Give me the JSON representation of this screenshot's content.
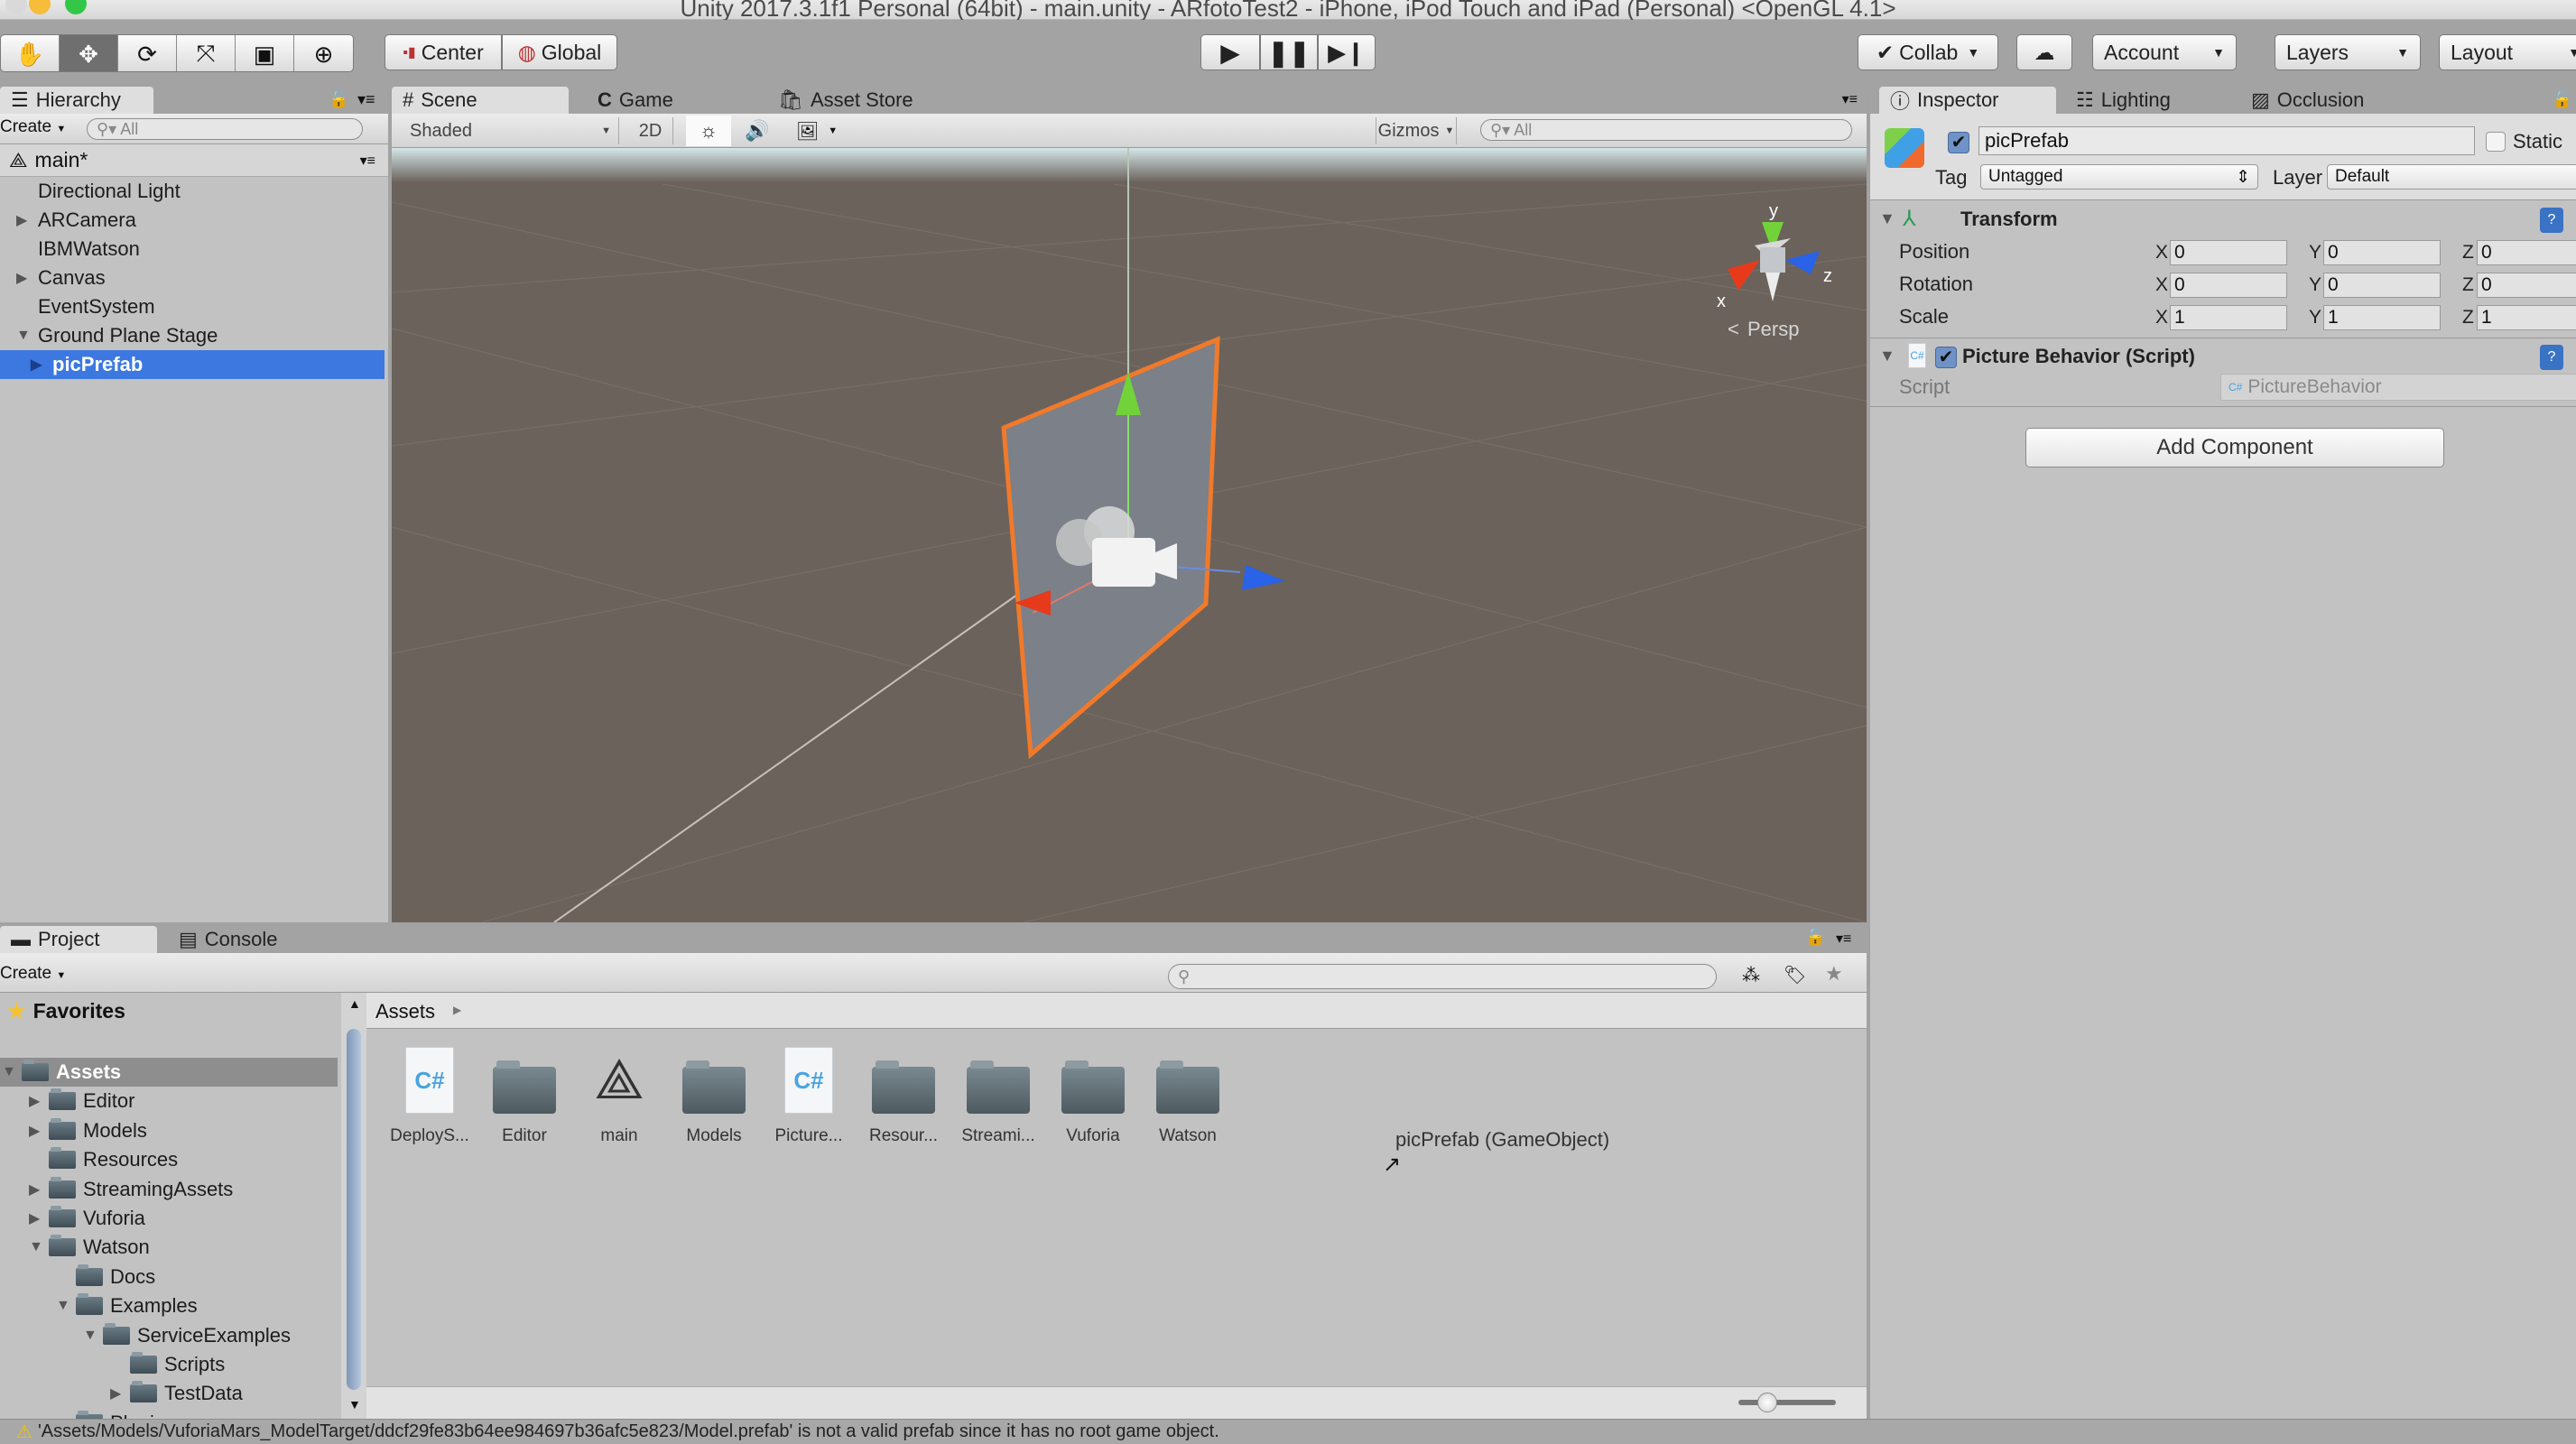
{
  "window": {
    "title": "Unity 2017.3.1f1 Personal (64bit) - main.unity - ARfotoTest2 - iPhone, iPod Touch and iPad (Personal) <OpenGL 4.1>"
  },
  "toolbar": {
    "tools": [
      "hand-tool",
      "move-tool",
      "rotate-tool",
      "scale-tool",
      "rect-tool",
      "transform-tool"
    ],
    "pivot_label": "Center",
    "space_label": "Global",
    "collab_label": "Collab",
    "account_label": "Account",
    "layers_label": "Layers",
    "layout_label": "Layout"
  },
  "hierarchy": {
    "tab_label": "Hierarchy",
    "create_label": "Create",
    "search_placeholder": "All",
    "scene_name": "main*",
    "items": [
      {
        "label": "Directional Light",
        "arrow": "",
        "indent": 1
      },
      {
        "label": "ARCamera",
        "arrow": "▶",
        "indent": 1
      },
      {
        "label": "IBMWatson",
        "arrow": "",
        "indent": 1
      },
      {
        "label": "Canvas",
        "arrow": "▶",
        "indent": 1
      },
      {
        "label": "EventSystem",
        "arrow": "",
        "indent": 1
      },
      {
        "label": "Ground Plane Stage",
        "arrow": "▼",
        "indent": 1
      },
      {
        "label": "picPrefab",
        "arrow": "▶",
        "indent": 2,
        "selected": true
      }
    ]
  },
  "scene_view": {
    "tabs": [
      {
        "label": "Scene",
        "icon": "#",
        "active": true
      },
      {
        "label": "Game",
        "icon": "C",
        "active": false
      },
      {
        "label": "Asset Store",
        "icon": "🛍",
        "active": false
      }
    ],
    "shading_mode": "Shaded",
    "toggle_2d": "2D",
    "gizmos_label": "Gizmos",
    "search_placeholder": "All",
    "projection_label": "Persp",
    "axis_labels": {
      "x": "x",
      "y": "y",
      "z": "z"
    }
  },
  "inspector": {
    "tabs": [
      {
        "label": "Inspector",
        "active": true
      },
      {
        "label": "Lighting",
        "active": false
      },
      {
        "label": "Occlusion",
        "active": false
      }
    ],
    "object_name": "picPrefab",
    "active_checked": true,
    "static_label": "Static",
    "static_checked": false,
    "tag_label": "Tag",
    "tag_value": "Untagged",
    "layer_label": "Layer",
    "layer_value": "Default",
    "transform": {
      "title": "Transform",
      "rows": [
        {
          "label": "Position",
          "x": "0",
          "y": "0",
          "z": "0"
        },
        {
          "label": "Rotation",
          "x": "0",
          "y": "0",
          "z": "0"
        },
        {
          "label": "Scale",
          "x": "1",
          "y": "1",
          "z": "1"
        }
      ]
    },
    "script_component": {
      "title": "Picture Behavior (Script)",
      "enabled": true,
      "script_label": "Script",
      "script_value": "PictureBehavior"
    },
    "add_component_label": "Add Component"
  },
  "project": {
    "tabs": [
      {
        "label": "Project",
        "active": true
      },
      {
        "label": "Console",
        "active": false
      }
    ],
    "create_label": "Create",
    "favorites_label": "Favorites",
    "tree": [
      {
        "label": "Assets",
        "arrow": "▼",
        "indent": 0,
        "selected": true
      },
      {
        "label": "Editor",
        "arrow": "▶",
        "indent": 1
      },
      {
        "label": "Models",
        "arrow": "▶",
        "indent": 1
      },
      {
        "label": "Resources",
        "arrow": "",
        "indent": 1
      },
      {
        "label": "StreamingAssets",
        "arrow": "▶",
        "indent": 1
      },
      {
        "label": "Vuforia",
        "arrow": "▶",
        "indent": 1
      },
      {
        "label": "Watson",
        "arrow": "▼",
        "indent": 1
      },
      {
        "label": "Docs",
        "arrow": "",
        "indent": 2
      },
      {
        "label": "Examples",
        "arrow": "▼",
        "indent": 2
      },
      {
        "label": "ServiceExamples",
        "arrow": "▼",
        "indent": 3
      },
      {
        "label": "Scripts",
        "arrow": "",
        "indent": 4
      },
      {
        "label": "TestData",
        "arrow": "▶",
        "indent": 4
      },
      {
        "label": "Plugins",
        "arrow": "",
        "indent": 2
      }
    ],
    "breadcrumb": "Assets",
    "assets": [
      {
        "label": "DeployS...",
        "type": "cs-script"
      },
      {
        "label": "Editor",
        "type": "folder"
      },
      {
        "label": "main",
        "type": "unity-scene"
      },
      {
        "label": "Models",
        "type": "folder"
      },
      {
        "label": "Picture...",
        "type": "cs-script"
      },
      {
        "label": "Resour...",
        "type": "folder"
      },
      {
        "label": "Streami...",
        "type": "folder"
      },
      {
        "label": "Vuforia",
        "type": "folder"
      },
      {
        "label": "Watson",
        "type": "folder"
      }
    ],
    "drag_tooltip": "picPrefab (GameObject)",
    "icon_size_fraction": 0.3
  },
  "status": {
    "message": "'Assets/Models/VuforiaMars_ModelTarget/ddcf29fe83b64ee984697b36afc5e823/Model.prefab' is not a valid prefab since it has no root game object."
  }
}
